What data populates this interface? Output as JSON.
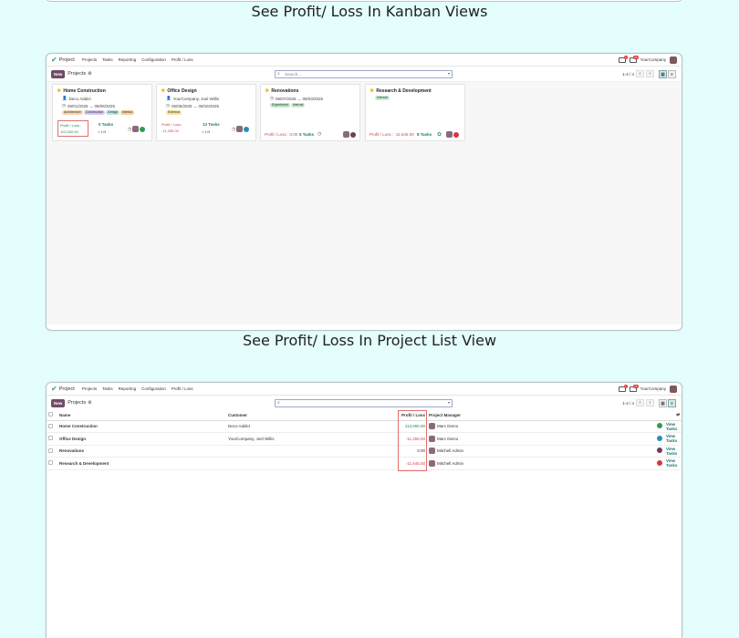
{
  "sections": {
    "kanban_caption": "See Profit/ Loss In Kanban Views",
    "list_caption": "See Profit/ Loss In Project List View"
  },
  "navbar": {
    "app": "Project",
    "menu": [
      "Projects",
      "Tasks",
      "Reporting",
      "Configuration",
      "Profit / Loss"
    ],
    "chat_badge": "1",
    "activity_badge": "25",
    "company": "YourCompany"
  },
  "control": {
    "new_label": "New",
    "breadcrumb": "Projects",
    "search_placeholder": "Search...",
    "pager": "1-4 / 4"
  },
  "kanban": {
    "cards": [
      {
        "title": "Home Construction",
        "customer": "Deco Addict",
        "dates": "06/01/2025 → 08/05/2025",
        "tags": [
          {
            "label": "Architecture",
            "color": "#f6d6b0"
          },
          {
            "label": "Construction",
            "color": "#d5c9f0"
          },
          {
            "label": "Design",
            "color": "#b8e5e0"
          },
          {
            "label": "Interior",
            "color": "#f3cf9a"
          }
        ],
        "pl_label": "Profit / Loss :",
        "pl_value": "113,000.00",
        "tasks": "0 Tasks",
        "subtasks": "1/3",
        "status": "#2e9e4f"
      },
      {
        "title": "Office Design",
        "customer": "YourCompany, Joel Willis",
        "dates": "06/05/2025 → 09/15/2025",
        "tags": [
          {
            "label": "External",
            "color": "#f7e39b"
          }
        ],
        "pl_label": "Profit / Loss :",
        "pl_value": "-11,265.00",
        "tasks": "13 Tasks",
        "subtasks": "1/3",
        "status": "#2a8fb5"
      },
      {
        "title": "Renovations",
        "customer": "",
        "dates": "06/07/2025 → 08/03/2025",
        "tags": [
          {
            "label": "Experiment",
            "color": "#bfe8c9"
          },
          {
            "label": "Internal",
            "color": "#c6ecd2"
          }
        ],
        "pl_label": "Profit / Loss : 0.00",
        "pl_value": "",
        "tasks": "5 Tasks",
        "subtasks": "",
        "status": "#6b3f5a"
      },
      {
        "title": "Research & Development",
        "customer": "",
        "dates": "",
        "tags": [
          {
            "label": "Internal",
            "color": "#c6ecd2"
          }
        ],
        "pl_label": "Profit / Loss : -11,645.00",
        "pl_value": "",
        "tasks": "8 Tasks",
        "subtasks": "",
        "status": "#d9363e"
      }
    ]
  },
  "list": {
    "headers": {
      "name": "Name",
      "customer": "Customer",
      "pl": "Profit / Loss",
      "pm": "Project Manager"
    },
    "rows": [
      {
        "name": "Home Construction",
        "customer": "Deco Addict",
        "pl": "113,000.00",
        "pl_sign": "pos",
        "pm": "Marc Demo",
        "status": "#2e9e4f",
        "action": "View Tasks"
      },
      {
        "name": "Office Design",
        "customer": "YourCompany, Joel Willis",
        "pl": "-11,265.00",
        "pl_sign": "neg",
        "pm": "Marc Demo",
        "status": "#2a8fb5",
        "action": "View Tasks"
      },
      {
        "name": "Renovations",
        "customer": "",
        "pl": "0.00",
        "pl_sign": "zero",
        "pm": "Mitchell Admin",
        "status": "#6b3f5a",
        "action": "View Tasks"
      },
      {
        "name": "Research & Development",
        "customer": "",
        "pl": "-11,645.00",
        "pl_sign": "neg",
        "pm": "Mitchell Admin",
        "status": "#d9363e",
        "action": "View Tasks"
      }
    ]
  }
}
